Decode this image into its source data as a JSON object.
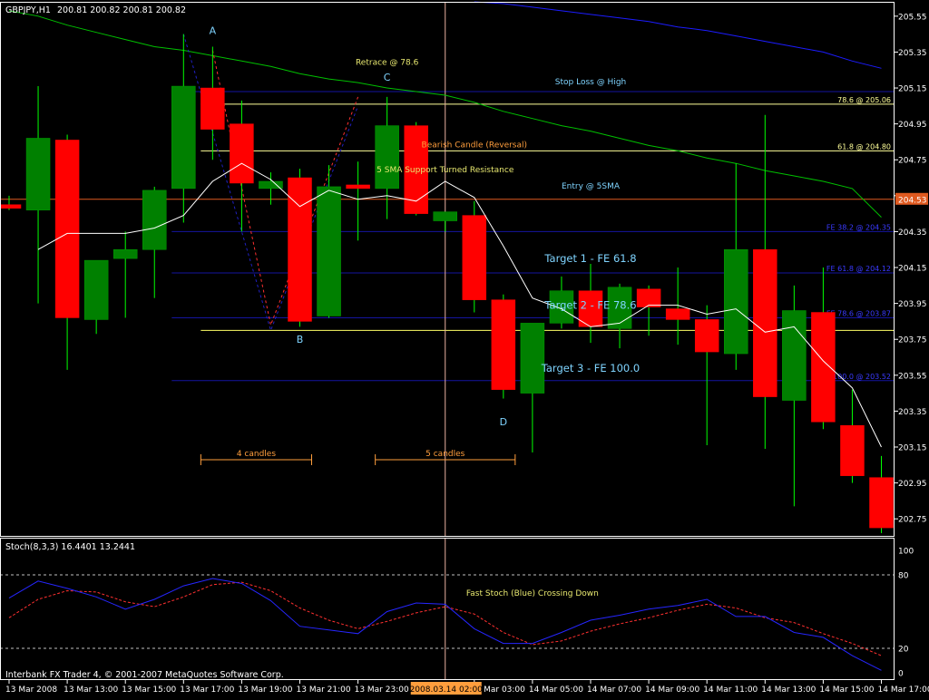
{
  "colors": {
    "background": "#000000",
    "frame": "#ffffff",
    "bull": "#008000",
    "bear": "#ff0000",
    "wick": "#00ff00",
    "sma5": "#ffffff",
    "sma_green": "#00c000",
    "sma_blue": "#1c1cff",
    "fib_yellow": "#ffff99",
    "fib_blue": "#1414a0",
    "annot_cyan": "#7fd4ff",
    "annot_yellow": "#e8e870",
    "orange": "#ff9e3d",
    "entry_line": "#e05a20",
    "stoch_fast": "#2626ff",
    "stoch_slow": "#ff3030",
    "cursor": "#e8b0a0",
    "price_tag": "#e05a20",
    "time_tag": "#ff9e3d"
  },
  "header": {
    "symbol": "GBPJPY,H1",
    "ohlc": "200.81 200.82 200.81 200.82"
  },
  "footer": "Interbank FX Trader 4, © 2001-2007 MetaQuotes Software Corp.",
  "price_tag": "204.53",
  "time_tag": "2008.03.14 02:00",
  "chart_data": [
    {
      "type": "candlestick",
      "ylim": [
        202.65,
        205.63
      ],
      "yticks": [
        "205.55",
        "205.35",
        "205.15",
        "204.95",
        "204.75",
        "204.55",
        "204.35",
        "204.15",
        "203.95",
        "203.75",
        "203.55",
        "203.35",
        "203.15",
        "202.95",
        "202.75"
      ],
      "ytick_values": [
        205.55,
        205.35,
        205.15,
        204.95,
        204.75,
        204.55,
        204.35,
        204.15,
        203.95,
        203.75,
        203.55,
        203.35,
        203.15,
        202.95,
        202.75
      ],
      "xticks": [
        "13 Mar 2008",
        "13 Mar 13:00",
        "13 Mar 15:00",
        "13 Mar 17:00",
        "13 Mar 19:00",
        "13 Mar 21:00",
        "13 Mar 23:00",
        "14 Mar 03:00",
        "14 Mar 05:00",
        "14 Mar 07:00",
        "14 Mar 09:00",
        "14 Mar 11:00",
        "14 Mar 13:00",
        "14 Mar 15:00",
        "14 Mar 17:00"
      ],
      "xtick_bars": [
        0,
        2,
        4,
        6,
        8,
        10,
        12,
        16,
        18,
        20,
        22,
        24,
        26,
        28,
        30
      ],
      "cursor_bar": 15,
      "candles": [
        {
          "o": 204.5,
          "h": 204.55,
          "l": 204.47,
          "c": 204.48
        },
        {
          "o": 204.47,
          "h": 205.16,
          "l": 203.95,
          "c": 204.87
        },
        {
          "o": 204.86,
          "h": 204.89,
          "l": 203.58,
          "c": 203.87
        },
        {
          "o": 203.86,
          "h": 204.18,
          "l": 203.78,
          "c": 204.19
        },
        {
          "o": 204.2,
          "h": 204.35,
          "l": 203.87,
          "c": 204.25
        },
        {
          "o": 204.25,
          "h": 204.6,
          "l": 203.98,
          "c": 204.58
        },
        {
          "o": 204.59,
          "h": 205.45,
          "l": 204.4,
          "c": 205.16
        },
        {
          "o": 205.15,
          "h": 205.38,
          "l": 204.75,
          "c": 204.92
        },
        {
          "o": 204.95,
          "h": 205.08,
          "l": 204.35,
          "c": 204.62
        },
        {
          "o": 204.59,
          "h": 204.68,
          "l": 204.5,
          "c": 204.63
        },
        {
          "o": 204.65,
          "h": 204.7,
          "l": 203.82,
          "c": 203.85
        },
        {
          "o": 203.88,
          "h": 204.72,
          "l": 203.87,
          "c": 204.6
        },
        {
          "o": 204.61,
          "h": 204.74,
          "l": 204.3,
          "c": 204.59
        },
        {
          "o": 204.59,
          "h": 205.1,
          "l": 204.42,
          "c": 204.94
        },
        {
          "o": 204.94,
          "h": 204.96,
          "l": 204.44,
          "c": 204.45
        },
        {
          "o": 204.41,
          "h": 204.45,
          "l": 204.35,
          "c": 204.46
        },
        {
          "o": 204.44,
          "h": 204.52,
          "l": 203.9,
          "c": 203.97
        },
        {
          "o": 203.97,
          "h": 204.0,
          "l": 203.42,
          "c": 203.47
        },
        {
          "o": 203.45,
          "h": 203.83,
          "l": 203.12,
          "c": 203.84
        },
        {
          "o": 203.84,
          "h": 204.1,
          "l": 203.81,
          "c": 204.02
        },
        {
          "o": 204.02,
          "h": 204.17,
          "l": 203.73,
          "c": 203.82
        },
        {
          "o": 203.81,
          "h": 204.06,
          "l": 203.7,
          "c": 204.04
        },
        {
          "o": 204.03,
          "h": 204.05,
          "l": 203.77,
          "c": 203.93
        },
        {
          "o": 203.92,
          "h": 204.15,
          "l": 203.72,
          "c": 203.86
        },
        {
          "o": 203.86,
          "h": 203.94,
          "l": 203.16,
          "c": 203.68
        },
        {
          "o": 203.67,
          "h": 204.73,
          "l": 203.58,
          "c": 204.25
        },
        {
          "o": 204.25,
          "h": 205.0,
          "l": 203.14,
          "c": 203.43
        },
        {
          "o": 203.41,
          "h": 204.05,
          "l": 202.82,
          "c": 203.91
        },
        {
          "o": 203.9,
          "h": 204.15,
          "l": 203.25,
          "c": 203.29
        },
        {
          "o": 203.27,
          "h": 203.47,
          "l": 202.95,
          "c": 202.99
        },
        {
          "o": 202.98,
          "h": 203.1,
          "l": 202.67,
          "c": 202.7
        }
      ],
      "sma5": [
        null,
        204.25,
        204.34,
        204.34,
        204.34,
        204.37,
        204.44,
        204.63,
        204.73,
        204.64,
        204.49,
        204.58,
        204.53,
        204.55,
        204.52,
        204.63,
        204.54,
        204.27,
        203.98,
        203.92,
        203.82,
        203.84,
        203.94,
        203.94,
        203.89,
        203.92,
        203.79,
        203.82,
        203.63,
        203.48,
        203.15
      ],
      "sma_green": [
        205.58,
        205.55,
        205.5,
        205.46,
        205.42,
        205.38,
        205.36,
        205.33,
        205.3,
        205.27,
        205.23,
        205.2,
        205.18,
        205.15,
        205.13,
        205.11,
        205.07,
        205.02,
        204.98,
        204.94,
        204.91,
        204.87,
        204.83,
        204.8,
        204.76,
        204.73,
        204.69,
        204.66,
        204.63,
        204.59,
        204.43
      ],
      "sma_blue": [
        null,
        null,
        null,
        null,
        null,
        null,
        null,
        null,
        null,
        null,
        null,
        null,
        null,
        null,
        null,
        null,
        205.63,
        205.62,
        205.6,
        205.58,
        205.56,
        205.54,
        205.52,
        205.49,
        205.47,
        205.44,
        205.41,
        205.38,
        205.35,
        205.3,
        205.26
      ],
      "fib_levels": [
        {
          "label": "78.6 @ 205.06",
          "price": 205.06,
          "color_key": "fib_yellow",
          "from_bar": 7,
          "label_end": true
        },
        {
          "label": "61.8 @ 204.80",
          "price": 204.8,
          "color_key": "fib_yellow",
          "from_bar": 7,
          "label_end": true
        },
        {
          "label": "FE 38.2 @ 204.35",
          "price": 204.35,
          "color_key": "fib_blue",
          "from_bar": 6,
          "label_end": true
        },
        {
          "label": "FE 61.8 @ 204.12",
          "price": 204.12,
          "color_key": "fib_blue",
          "from_bar": 6,
          "label_end": true
        },
        {
          "label": "FE 78.6 @ 203.87",
          "price": 203.87,
          "color_key": "fib_blue",
          "from_bar": 6,
          "label_end": true
        },
        {
          "label": "FE 100.0 @ 203.52",
          "price": 203.52,
          "color_key": "fib_blue",
          "from_bar": 6,
          "label_end": true
        }
      ],
      "stop_line": {
        "price": 205.13,
        "from_bar": 6
      },
      "white_level": {
        "price": 203.8,
        "from_bar": 7
      },
      "entry_line": {
        "price": 204.53
      },
      "annotations": [
        {
          "text": "A",
          "bar": 7,
          "price": 205.45,
          "color_key": "annot_cyan"
        },
        {
          "text": "B",
          "bar": 10,
          "price": 203.73,
          "color_key": "annot_cyan"
        },
        {
          "text": "C",
          "bar": 13,
          "price": 205.19,
          "color_key": "annot_cyan"
        },
        {
          "text": "D",
          "bar": 17,
          "price": 203.27,
          "color_key": "annot_cyan"
        },
        {
          "text": "Retrace @ 78.6",
          "bar": 13,
          "price": 205.28,
          "color_key": "annot_yellow"
        },
        {
          "text": "Stop Loss @ High",
          "bar": 20,
          "price": 205.17,
          "color_key": "annot_cyan"
        },
        {
          "text": "Bearish Candle (Reversal)",
          "bar": 16,
          "price": 204.82,
          "color_key": "orange"
        },
        {
          "text": "5 SMA Support Turned Resistance",
          "bar": 15,
          "price": 204.68,
          "color_key": "annot_yellow"
        },
        {
          "text": "Entry @ 5SMA",
          "bar": 20,
          "price": 204.59,
          "color_key": "annot_cyan"
        },
        {
          "text": "Target 1 - FE 61.8",
          "bar": 20,
          "price": 204.18,
          "color_key": "annot_cyan"
        },
        {
          "text": "Target 2 - FE 78.6",
          "bar": 20,
          "price": 203.92,
          "color_key": "annot_cyan"
        },
        {
          "text": "Target 3 - FE 100.0",
          "bar": 20,
          "price": 203.57,
          "color_key": "annot_cyan"
        }
      ],
      "abcd_points": [
        {
          "bar": 7,
          "price": 205.36
        },
        {
          "bar": 9,
          "price": 203.83
        },
        {
          "bar": 12,
          "price": 205.1
        }
      ],
      "candle_spans": [
        {
          "text": "4 candles",
          "from_bar": 7,
          "to_bar": 10,
          "price": 203.15
        },
        {
          "text": "5 candles",
          "from_bar": 13,
          "to_bar": 17,
          "price": 203.15
        }
      ]
    },
    {
      "type": "line",
      "title": "Stoch(8,3,3) 16.4401 13.2441",
      "ylim": [
        0,
        100
      ],
      "yticks": [
        "100",
        "80",
        "20",
        "0"
      ],
      "ytick_values": [
        100,
        80,
        20,
        0
      ],
      "levels": [
        80,
        20
      ],
      "annotation": {
        "text": "Fast Stoch (Blue) Crossing Down",
        "bar": 18,
        "value": 63
      },
      "series": [
        {
          "color_key": "stoch_fast",
          "values": [
            61,
            75,
            69,
            62,
            52,
            60,
            71,
            77,
            73,
            59,
            38,
            35,
            32,
            50,
            57,
            56,
            36,
            24,
            24,
            33,
            43,
            47,
            52,
            55,
            60,
            46,
            46,
            33,
            29,
            14,
            2
          ]
        },
        {
          "color_key": "stoch_slow",
          "values": [
            45,
            60,
            67,
            66,
            58,
            54,
            62,
            72,
            74,
            67,
            53,
            43,
            36,
            42,
            49,
            54,
            48,
            33,
            23,
            26,
            34,
            40,
            45,
            51,
            56,
            53,
            45,
            41,
            32,
            24,
            14
          ]
        }
      ]
    }
  ]
}
